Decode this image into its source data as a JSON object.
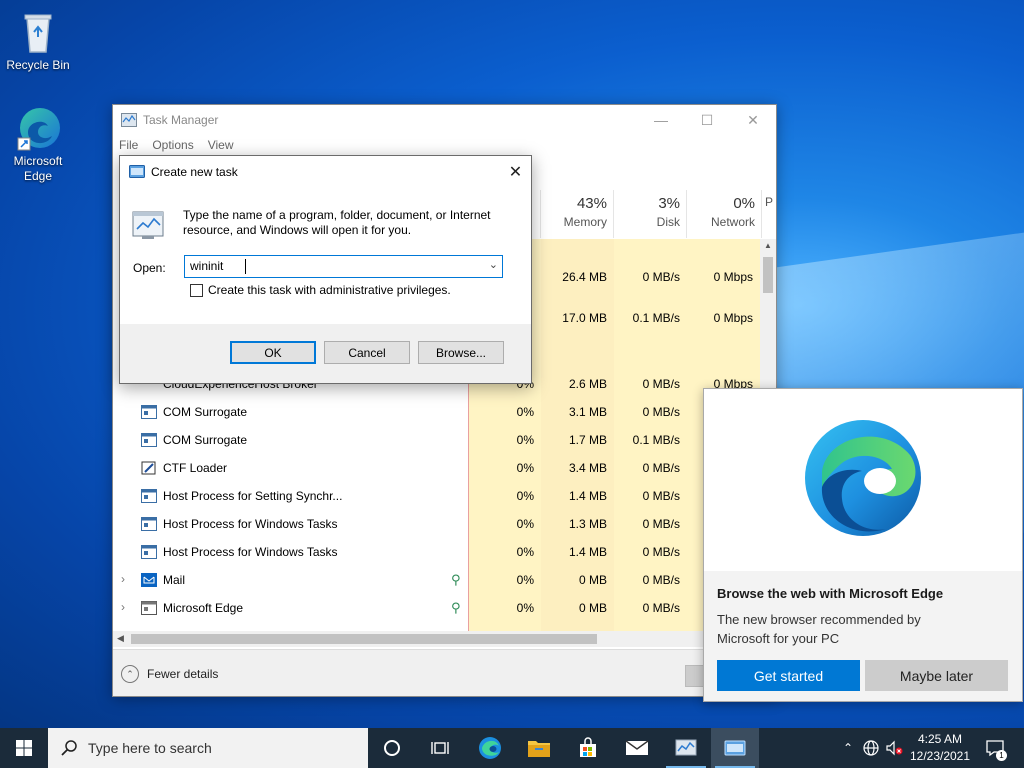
{
  "desktop": {
    "icons": [
      {
        "label": "Recycle Bin"
      },
      {
        "label": "Microsoft Edge"
      }
    ]
  },
  "task_manager": {
    "title": "Task Manager",
    "menu": [
      "File",
      "Options",
      "View"
    ],
    "columns": [
      {
        "pct": "43%",
        "label": "Memory"
      },
      {
        "pct": "3%",
        "label": "Disk"
      },
      {
        "pct": "0%",
        "label": "Network"
      },
      {
        "pct": "",
        "label": "P"
      }
    ],
    "rows": [
      {
        "name": "",
        "cpu": "",
        "mem": "26.4 MB",
        "disk": "0 MB/s",
        "net": "0 Mbps"
      },
      {
        "name": "",
        "cpu": "",
        "mem": "17.0 MB",
        "disk": "0.1 MB/s",
        "net": "0 Mbps"
      },
      {
        "name": "CloudExperienceHost Broker",
        "cpu": "0%",
        "mem": "2.6 MB",
        "disk": "0 MB/s",
        "net": "0 Mbps"
      },
      {
        "name": "COM Surrogate",
        "cpu": "0%",
        "mem": "3.1 MB",
        "disk": "0 MB/s",
        "net": ""
      },
      {
        "name": "COM Surrogate",
        "cpu": "0%",
        "mem": "1.7 MB",
        "disk": "0.1 MB/s",
        "net": ""
      },
      {
        "name": "CTF Loader",
        "cpu": "0%",
        "mem": "3.4 MB",
        "disk": "0 MB/s",
        "net": ""
      },
      {
        "name": "Host Process for Setting Synchr...",
        "cpu": "0%",
        "mem": "1.4 MB",
        "disk": "0 MB/s",
        "net": ""
      },
      {
        "name": "Host Process for Windows Tasks",
        "cpu": "0%",
        "mem": "1.3 MB",
        "disk": "0 MB/s",
        "net": ""
      },
      {
        "name": "Host Process for Windows Tasks",
        "cpu": "0%",
        "mem": "1.4 MB",
        "disk": "0 MB/s",
        "net": ""
      },
      {
        "name": "Mail",
        "cpu": "0%",
        "mem": "0 MB",
        "disk": "0 MB/s",
        "net": ""
      },
      {
        "name": "Microsoft Edge",
        "cpu": "0%",
        "mem": "0 MB",
        "disk": "0 MB/s",
        "net": ""
      }
    ],
    "fewer_details": "Fewer details"
  },
  "dialog": {
    "title": "Create new task",
    "prompt": "Type the name of a program, folder, document, or Internet resource, and Windows will open it for you.",
    "open_label": "Open:",
    "open_value": "wininit",
    "admin_checkbox": "Create this task with administrative privileges.",
    "ok": "OK",
    "cancel": "Cancel",
    "browse": "Browse..."
  },
  "edge_promo": {
    "heading": "Browse the web with Microsoft Edge",
    "description": "The new browser recommended by Microsoft for your PC",
    "get_started": "Get started",
    "maybe_later": "Maybe later"
  },
  "taskbar": {
    "search_placeholder": "Type here to search",
    "time": "4:25 AM",
    "date": "12/23/2021",
    "notification_count": "1"
  },
  "colors": {
    "accent": "#0078d4",
    "taskbar": "#1b2b3a",
    "cpu_highlight": "#fff4c4"
  }
}
